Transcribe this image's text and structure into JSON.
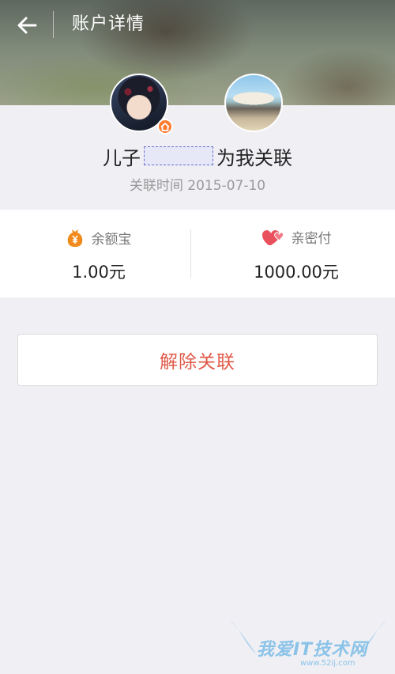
{
  "header": {
    "title": "账户详情",
    "back_icon": "arrow-left-icon"
  },
  "profile": {
    "name_prefix": "儿子",
    "name_suffix": "为我关联",
    "link_time": "关联时间 2015-07-10"
  },
  "stats": [
    {
      "label": "余额宝",
      "icon": "yuebao-coin-icon",
      "value": "1.00元"
    },
    {
      "label": "亲密付",
      "icon": "hearts-icon",
      "value": "1000.00元"
    }
  ],
  "actions": {
    "unlink_label": "解除关联"
  },
  "watermark": {
    "text": "我爱IT技术网",
    "url": "www.52ij.com"
  },
  "colors": {
    "page_bg": "#efeff4",
    "unlink_text": "#e05a4a",
    "badge_orange": "#ff7a2d",
    "coin_orange": "#f08a1c",
    "heart_red": "#e8505b"
  }
}
